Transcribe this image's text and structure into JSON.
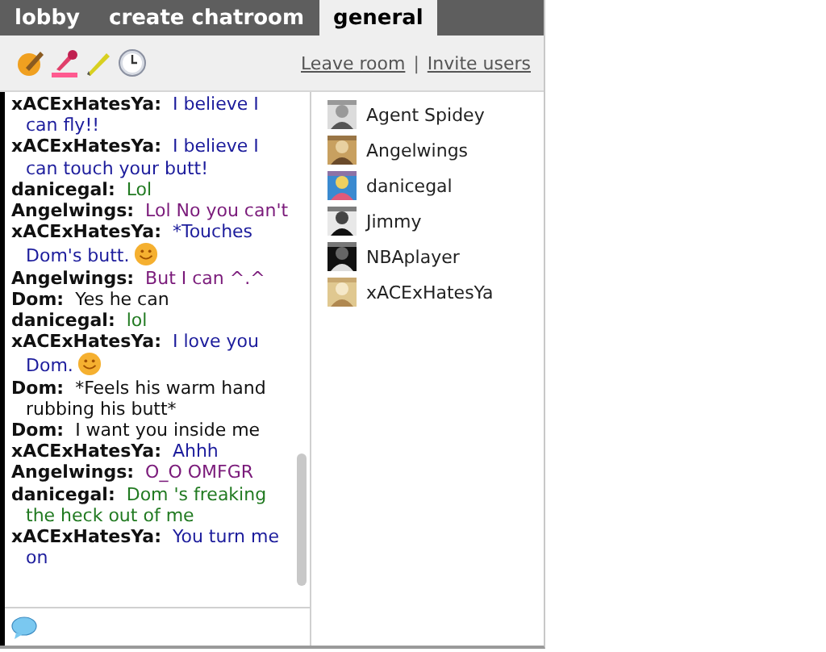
{
  "tabs": [
    {
      "label": "lobby",
      "selected": false
    },
    {
      "label": "create chatroom",
      "selected": false
    },
    {
      "label": "general",
      "selected": true
    }
  ],
  "toolbar": {
    "links": [
      "Leave room",
      "Invite users"
    ],
    "separator": "|"
  },
  "messages": [
    {
      "sender": "xACExHatesYa:",
      "text": "I believe I can fly!!",
      "color": "#1c1c9c",
      "emoticon": false
    },
    {
      "sender": "xACExHatesYa:",
      "text": "I believe I can touch your butt!",
      "color": "#1c1c9c",
      "emoticon": false
    },
    {
      "sender": "danicegal:",
      "text": "Lol",
      "color": "#217a21",
      "emoticon": false
    },
    {
      "sender": "Angelwings:",
      "text": "Lol No you can't",
      "color": "#7a1a7a",
      "emoticon": false
    },
    {
      "sender": "xACExHatesYa:",
      "text": "*Touches Dom's butt.",
      "color": "#1c1c9c",
      "emoticon": true
    },
    {
      "sender": "Angelwings:",
      "text": "But I can ^.^",
      "color": "#7a1a7a",
      "emoticon": false
    },
    {
      "sender": "Dom:",
      "text": "Yes he can",
      "color": "#111111",
      "emoticon": false
    },
    {
      "sender": "danicegal:",
      "text": "lol",
      "color": "#217a21",
      "emoticon": false
    },
    {
      "sender": "xACExHatesYa:",
      "text": "I love you Dom.",
      "color": "#1c1c9c",
      "emoticon": true
    },
    {
      "sender": "Dom:",
      "text": "*Feels his warm hand rubbing his butt*",
      "color": "#111111",
      "emoticon": false
    },
    {
      "sender": "Dom:",
      "text": "I want you inside me",
      "color": "#111111",
      "emoticon": false
    },
    {
      "sender": "xACExHatesYa:",
      "text": "Ahhh",
      "color": "#1c1c9c",
      "emoticon": false
    },
    {
      "sender": "Angelwings:",
      "text": "O_O OMFGR",
      "color": "#7a1a7a",
      "emoticon": false
    },
    {
      "sender": "danicegal:",
      "text": "Dom 's freaking the heck out of me",
      "color": "#217a21",
      "emoticon": false
    },
    {
      "sender": "xACExHatesYa:",
      "text": "You turn me on",
      "color": "#1c1c9c",
      "emoticon": false
    }
  ],
  "users": [
    {
      "name": "Agent Spidey"
    },
    {
      "name": "Angelwings"
    },
    {
      "name": "danicegal"
    },
    {
      "name": "Jimmy"
    },
    {
      "name": "NBAplayer"
    },
    {
      "name": "xACExHatesYa"
    }
  ]
}
